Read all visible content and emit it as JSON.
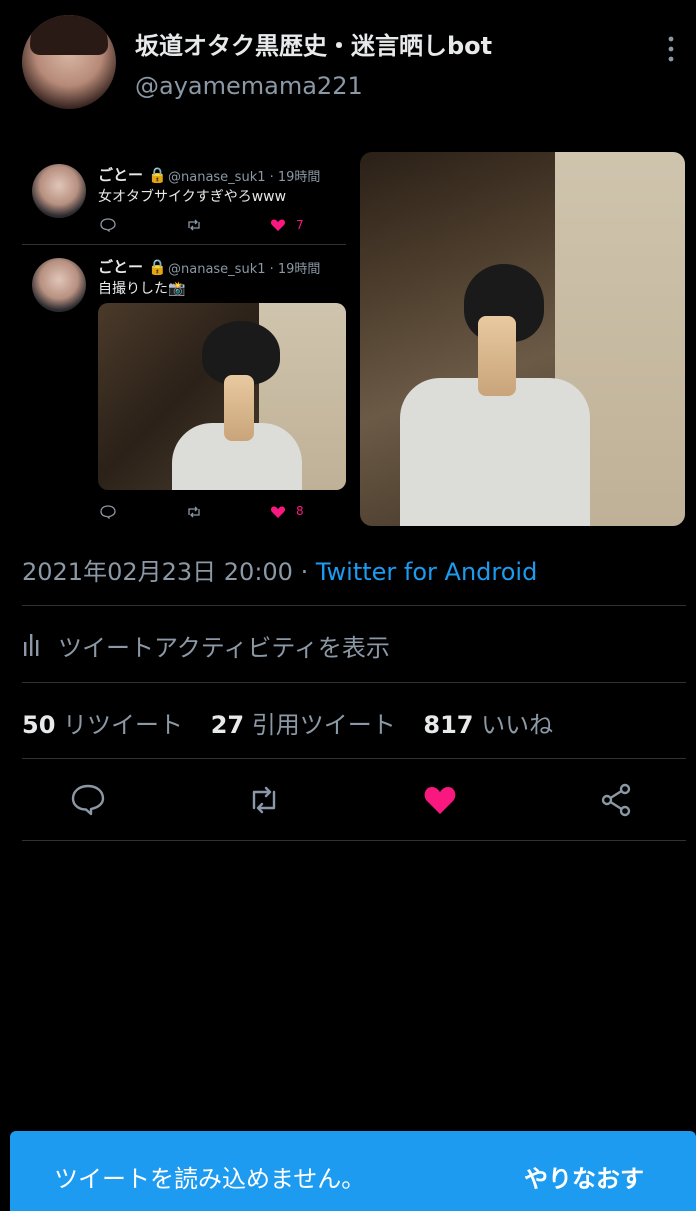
{
  "header": {
    "display_name": "坂道オタク黒歴史・迷言晒しbot",
    "handle": "@ayamemama221"
  },
  "embedded": {
    "tweets": [
      {
        "name": "ごとー",
        "handle": "@nanase_suk1 · 19時間",
        "text": "女オタブサイクすぎやろwww",
        "like_count": "7"
      },
      {
        "name": "ごとー",
        "handle": "@nanase_suk1 · 19時間",
        "text": "自撮りした📸",
        "like_count": "8"
      }
    ]
  },
  "meta": {
    "timestamp": "2021年02月23日 20:00",
    "separator": " · ",
    "source": "Twitter for Android"
  },
  "activity": {
    "label": "ツイートアクティビティを表示"
  },
  "stats": {
    "retweets_count": "50",
    "retweets_label": "リツイート",
    "quotes_count": "27",
    "quotes_label": "引用ツイート",
    "likes_count": "817",
    "likes_label": "いいね"
  },
  "banner": {
    "message": "ツイートを読み込めません。",
    "retry": "やりなおす"
  },
  "colors": {
    "background": "#000000",
    "accent": "#1d9bf0",
    "like": "#f91880",
    "muted": "#8b98a5"
  }
}
